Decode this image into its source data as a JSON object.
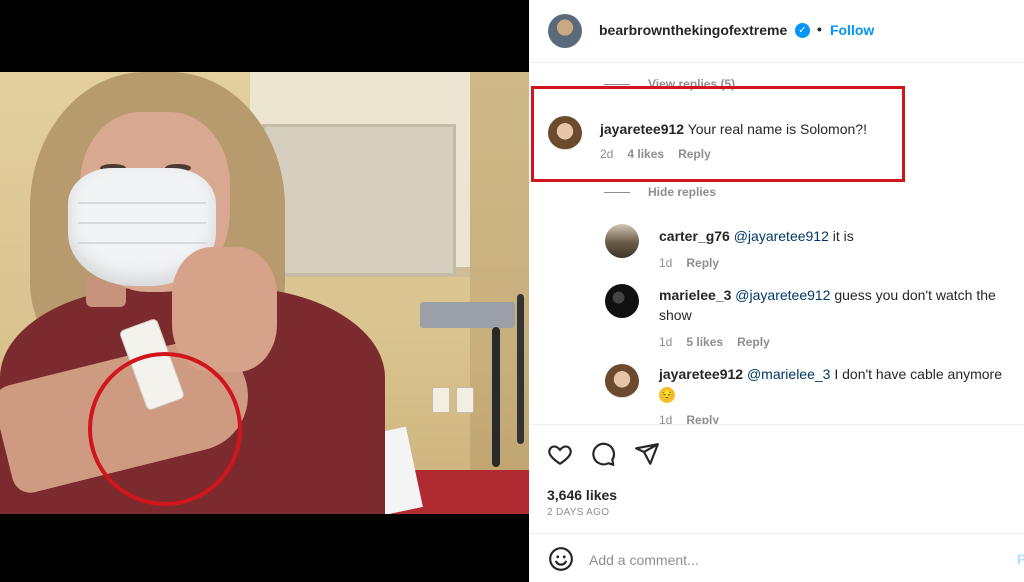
{
  "post": {
    "username": "bearbrownthekingofextreme",
    "follow_label": "Follow",
    "dot": "•",
    "verified_glyph": "✓"
  },
  "comments": {
    "view_replies": "View replies (5)",
    "hide_replies": "Hide replies",
    "items": [
      {
        "username": "jayaretee912",
        "text": "Your real name is Solomon?!",
        "time": "2d",
        "likes": "4 likes",
        "reply": "Reply"
      },
      {
        "username": "carter_g76",
        "mention": "@jayaretee912",
        "text": " it is",
        "time": "1d",
        "reply": "Reply"
      },
      {
        "username": "marielee_3",
        "mention": "@jayaretee912",
        "text": " guess you don't watch the show",
        "time": "1d",
        "likes": "5 likes",
        "reply": "Reply"
      },
      {
        "username": "jayaretee912",
        "mention": "@marielee_3",
        "text": " I don't have cable anymore",
        "emoji": "😔",
        "time": "1d",
        "reply": "Reply"
      }
    ]
  },
  "actions": {
    "likes": "3,646 likes",
    "time_ago": "2 DAYS AGO"
  },
  "add_comment": {
    "placeholder": "Add a comment...",
    "post_label": "Post"
  },
  "colors": {
    "accent": "#0095f6",
    "highlight": "#d0151c",
    "muted": "#8e8e8e"
  }
}
